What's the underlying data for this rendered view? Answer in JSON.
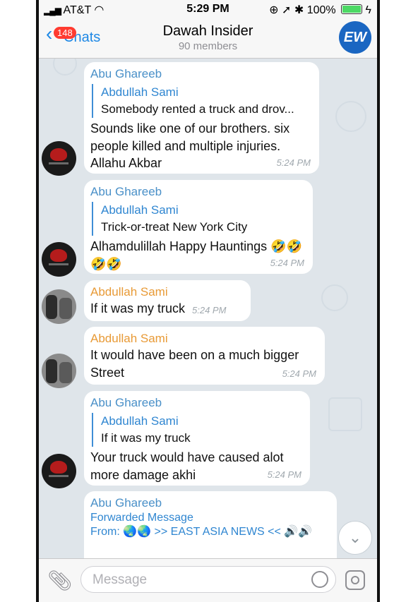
{
  "status_bar": {
    "carrier": "AT&T",
    "time": "5:29 PM",
    "battery": "100%"
  },
  "nav": {
    "back_badge": "148",
    "back_label": "Chats",
    "title": "Dawah Insider",
    "subtitle": "90 members",
    "channel_avatar_text": "EW"
  },
  "messages": [
    {
      "sender": "Abu Ghareeb",
      "reply_name": "Abdullah Sami",
      "reply_text": "Somebody rented a truck and drov...",
      "text": "Sounds like one of our brothers. six people killed and multiple injuries. Allahu Akbar",
      "time": "5:24 PM"
    },
    {
      "sender": "Abu Ghareeb",
      "reply_name": "Abdullah Sami",
      "reply_text": "Trick-or-treat New York City",
      "text": "Alhamdulillah Happy Hauntings 🤣🤣🤣🤣",
      "time": "5:24 PM"
    },
    {
      "sender": "Abdullah Sami",
      "text": "If it was my truck",
      "time": "5:24 PM"
    },
    {
      "sender": "Abdullah Sami",
      "text": "It would have been on a much bigger Street",
      "time": "5:24 PM"
    },
    {
      "sender": "Abu Ghareeb",
      "reply_name": "Abdullah Sami",
      "reply_text": "If it was my truck",
      "text": "Your truck would have caused alot more damage akhi",
      "time": "5:24 PM"
    },
    {
      "sender": "Abu Ghareeb",
      "forward_label": "Forwarded Message",
      "forward_from": "From: 🌏🌏 >> EAST ASIA NEWS << 🔊🔊"
    }
  ],
  "input": {
    "placeholder": "Message"
  },
  "icons": {
    "attach": "paperclip-icon",
    "sticker": "sticker-icon",
    "camera": "camera-icon",
    "scroll_down": "chevron-down-icon"
  }
}
